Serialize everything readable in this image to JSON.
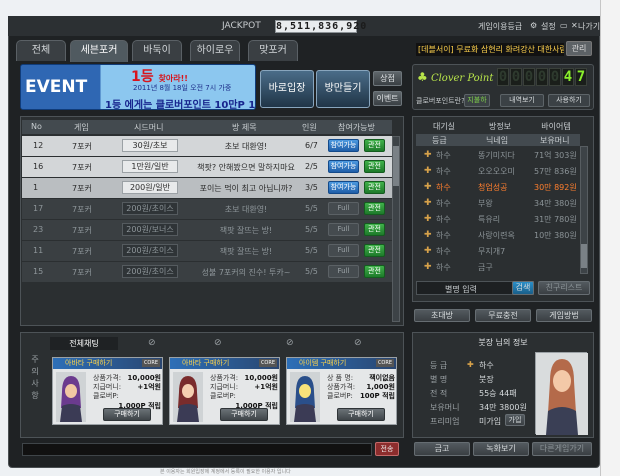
{
  "titlebar": {
    "jackpot_label": "JACKPOT",
    "jackpot_value": "8,511,836,920",
    "grade_label": "게임이용등급",
    "settings_label": "설정",
    "exit_label": "나가기"
  },
  "tabs": [
    {
      "label": "전체"
    },
    {
      "label": "세븐포커"
    },
    {
      "label": "바둑이"
    },
    {
      "label": "하이로우"
    },
    {
      "label": "맞포커"
    }
  ],
  "ticker": {
    "text": "[데블서이] 무료화 삼현리 화려강산 대한사람",
    "button": "관리"
  },
  "event": {
    "word": "EVENT",
    "first": "1등",
    "first_suffix": "찾아라!!",
    "date": "2011년 8월 18일 오전 7시 가중",
    "bottom": "1등 에게는 클로버포인트 10만P 1급"
  },
  "buttons": {
    "quick_join": "바로입장",
    "make_room": "방만들기",
    "shop": "상점",
    "event": "이벤트"
  },
  "clover": {
    "logo": "Clover Point",
    "digits": [
      "0",
      "0",
      "0",
      "0",
      "0",
      "4",
      "7"
    ],
    "question": "클로버포인트란?",
    "btn_exchange": "지불하",
    "btn_view": "내역보기",
    "btn_use": "사용하기"
  },
  "room_table": {
    "headers": [
      "No",
      "게임",
      "시드머니",
      "방 제목",
      "인원",
      "참여가능방"
    ],
    "rows": [
      {
        "no": "12",
        "game": "7포커",
        "seed": "30원/초보",
        "title": "초보 대환영!",
        "people": "6/7",
        "join": "참여가능",
        "watch": "관전",
        "state": "open"
      },
      {
        "no": "16",
        "game": "7포커",
        "seed": "1만원/일반",
        "title": "책팟? 안해봤으면 말하지마요",
        "people": "2/5",
        "join": "참여가능",
        "watch": "관전",
        "state": "open"
      },
      {
        "no": "1",
        "game": "7포커",
        "seed": "200원/일반",
        "title": "포이는 먹이 최고 아닙니까?",
        "people": "3/5",
        "join": "참여가능",
        "watch": "관전",
        "state": "selected"
      },
      {
        "no": "17",
        "game": "7포커",
        "seed": "200원/초이스",
        "title": "초보 대환영!",
        "people": "5/5",
        "join": "Full",
        "watch": "관전",
        "state": "full"
      },
      {
        "no": "23",
        "game": "7포커",
        "seed": "200원/보너스",
        "title": "잭팟 잘뜨는 방!",
        "people": "5/5",
        "join": "Full",
        "watch": "관전",
        "state": "full"
      },
      {
        "no": "11",
        "game": "7포커",
        "seed": "200원/초이스",
        "title": "잭팟 잘뜨는 방!",
        "people": "5/5",
        "join": "Full",
        "watch": "관전",
        "state": "full"
      },
      {
        "no": "15",
        "game": "7포커",
        "seed": "200원/초이스",
        "title": "성불 7포커의 진수! 투카~",
        "people": "5/5",
        "join": "Full",
        "watch": "관전",
        "state": "full"
      }
    ]
  },
  "users": {
    "tabs": [
      "대기실",
      "방정보",
      "바이어템"
    ],
    "headers": [
      "등급",
      "닉네임",
      "보유머니"
    ],
    "rows": [
      {
        "grade": "하수",
        "nick": "똥기미지다",
        "money": "71억 303원",
        "me": false
      },
      {
        "grade": "하수",
        "nick": "오오오오미",
        "money": "57만 836원",
        "me": false
      },
      {
        "grade": "하수",
        "nick": "청업성공",
        "money": "30만 892원",
        "me": true
      },
      {
        "grade": "하수",
        "nick": "부왕",
        "money": "34만 380원",
        "me": false
      },
      {
        "grade": "하수",
        "nick": "특유리",
        "money": "31만 780원",
        "me": false
      },
      {
        "grade": "하수",
        "nick": "사랑이련옥",
        "money": "10만 380원",
        "me": false
      },
      {
        "grade": "하수",
        "nick": "무지개7",
        "money": "",
        "me": false
      },
      {
        "grade": "하수",
        "nick": "금구",
        "money": "",
        "me": false
      }
    ],
    "input_label": "별명 입력",
    "search": "검색",
    "friends": "친구리스트"
  },
  "nav": {
    "invite": "초대방",
    "free_charge": "무료충전",
    "guide": "게임방법"
  },
  "shop": {
    "tab_all": "전체채팅",
    "side": "주의사항",
    "cards": [
      {
        "title": "아바타 구매하기",
        "tag": "CORE",
        "k1": "상품가격:",
        "v1": "10,000원",
        "k2": "지급머니:",
        "v2": "+1억원",
        "k3": "클로버P:",
        "v3": "1,000P 적립",
        "btn": "구매하기"
      },
      {
        "title": "아바타 구매하기",
        "tag": "CORE",
        "k1": "상품가격:",
        "v1": "10,000원",
        "k2": "지급머니:",
        "v2": "+1억원",
        "k3": "클로버P:",
        "v3": "1,000P 적립",
        "btn": "구매하기"
      },
      {
        "title": "아이템 구매하기",
        "tag": "CORE",
        "k1": "상 품 명:",
        "v1": "잭이없음",
        "k2": "상품가격:",
        "v2": "1,000원",
        "k3": "클로버P:",
        "v3": "100P 적립",
        "btn": "구매하기"
      }
    ],
    "send": "전송"
  },
  "profile": {
    "title": "붓장 님의 정보",
    "rows": [
      {
        "k": "등 급",
        "v": "하수"
      },
      {
        "k": "별 명",
        "v": "붓장"
      },
      {
        "k": "전 적",
        "v": "55승 44패"
      },
      {
        "k": "보유머니",
        "v": "34만 3800원"
      },
      {
        "k": "프리미엄",
        "v": "미가입"
      }
    ],
    "premium_btn": "가입",
    "btn_bank": "금고",
    "btn_album": "녹화보기",
    "btn_other": "다른게임가기"
  },
  "footer": "본 이용자는 회원입장에 계정에서 등록이 필요한 이용자 입니다"
}
